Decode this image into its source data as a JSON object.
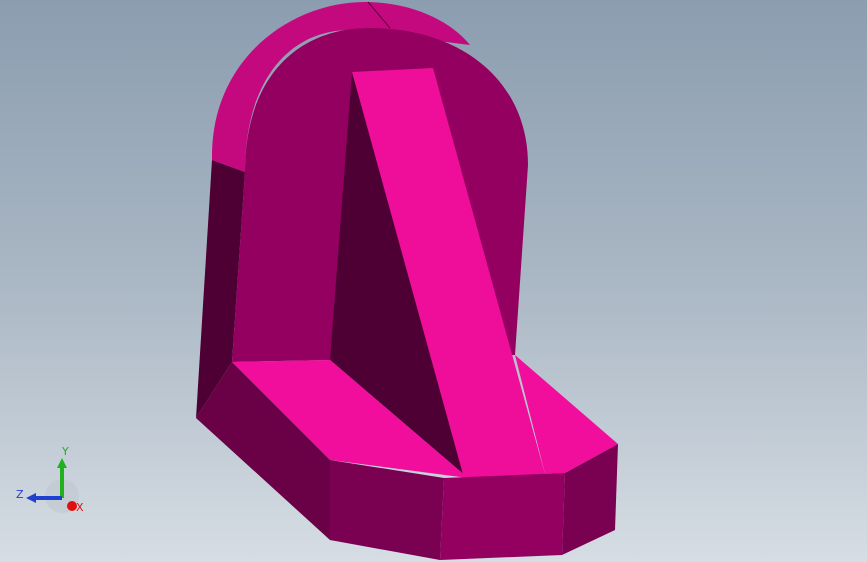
{
  "viewport": {
    "part_color": "#ee0e9a",
    "background_top": "#8b9db0",
    "background_bottom": "#d6dde4"
  },
  "triad": {
    "x_label": "X",
    "y_label": "Y",
    "z_label": "Z",
    "x_color": "#e01010",
    "y_color": "#20b020",
    "z_color": "#2040d0"
  }
}
